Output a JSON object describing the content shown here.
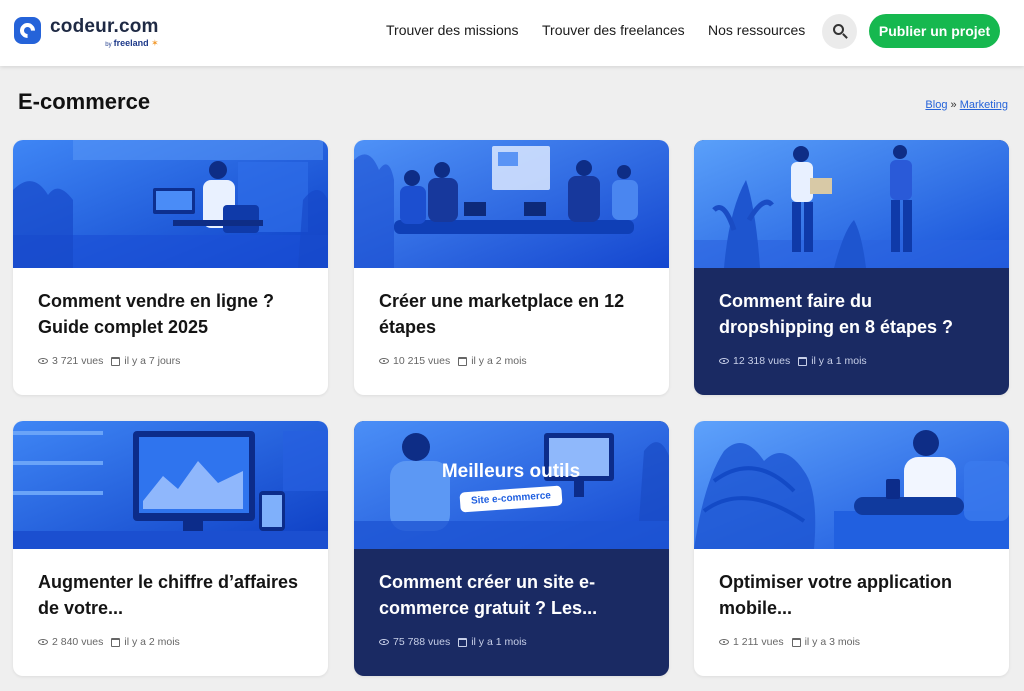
{
  "header": {
    "brand": "codeur.com",
    "brand_sub_by": "by",
    "brand_sub_name": "freeland",
    "nav": {
      "missions": "Trouver des missions",
      "freelances": "Trouver des freelances",
      "ressources": "Nos ressources"
    },
    "publish_label": "Publier un projet"
  },
  "page": {
    "title": "E-commerce",
    "breadcrumb": [
      "Blog",
      "Marketing"
    ],
    "breadcrumb_sep": "»"
  },
  "cards": [
    {
      "title": "Comment vendre en ligne ? Guide complet 2025",
      "views": "3 721 vues",
      "date": "il y a 7 jours",
      "dark": false
    },
    {
      "title": "Créer une marketplace en 12 étapes",
      "views": "10 215 vues",
      "date": "il y a 2 mois",
      "dark": false
    },
    {
      "title": "Comment faire du dropshipping en 8 étapes ?",
      "views": "12 318 vues",
      "date": "il y a 1 mois",
      "dark": true
    },
    {
      "title": "Augmenter le chiffre d’affaires de votre...",
      "views": "2 840 vues",
      "date": "il y a 2 mois",
      "dark": false
    },
    {
      "title": "Comment créer un site e-commerce gratuit ? Les...",
      "views": "75 788 vues",
      "date": "il y a 1 mois",
      "dark": true,
      "overlay_title": "Meilleurs outils",
      "overlay_pill": "Site e-commerce"
    },
    {
      "title": "Optimiser votre application mobile...",
      "views": "1 211 vues",
      "date": "il y a 3 mois",
      "dark": false
    }
  ],
  "colors": {
    "brand_blue": "#2563d9",
    "publish_green": "#16b84f",
    "dark_card": "#1a2a63"
  }
}
